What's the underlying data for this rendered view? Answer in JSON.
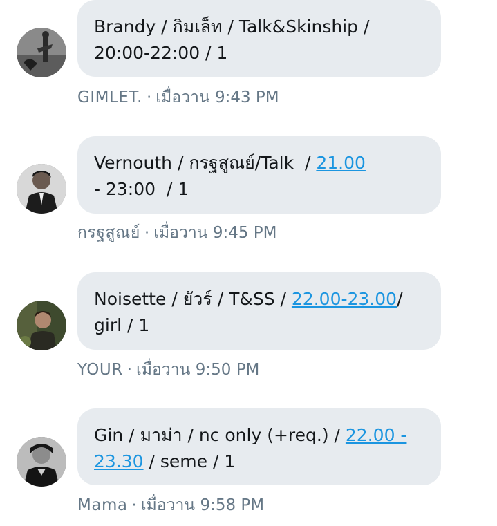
{
  "messages": [
    {
      "segments": [
        {
          "text": "Brandy / กิมเล็ท / Talk&Skinship /\n20:00-22:00 / 1",
          "link": false
        }
      ],
      "sender": "GIMLET.",
      "separator": "·",
      "time": "เมื่อวาน 9:43 PM",
      "avatar_icon": "profile-photo-icon"
    },
    {
      "segments": [
        {
          "text": "Vernouth / กรฐสูณย์/Talk  / ",
          "link": false
        },
        {
          "text": "21.00",
          "link": true
        },
        {
          "text": "\n- 23:00  / 1",
          "link": false
        }
      ],
      "sender": "กรฐสูณย์",
      "separator": "·",
      "time": "เมื่อวาน 9:45 PM",
      "avatar_icon": "profile-photo-icon"
    },
    {
      "segments": [
        {
          "text": "Noisette / ยัวร์ / T&SS / ",
          "link": false
        },
        {
          "text": "22.00-23.00",
          "link": true
        },
        {
          "text": "/\ngirl / 1",
          "link": false
        }
      ],
      "sender": "YOUR",
      "separator": "·",
      "time": "เมื่อวาน 9:50 PM",
      "avatar_icon": "profile-photo-icon"
    },
    {
      "segments": [
        {
          "text": "Gin / มาม่า / nc only (+req.) / ",
          "link": false
        },
        {
          "text": "22.00 -\n23.30",
          "link": true
        },
        {
          "text": " / seme / 1",
          "link": false
        }
      ],
      "sender": "Mama",
      "separator": "·",
      "time": "เมื่อวาน 9:58 PM",
      "avatar_icon": "profile-photo-icon"
    }
  ],
  "colors": {
    "bubble_bg": "#e7ebef",
    "text": "#14171a",
    "link": "#1b95e0",
    "meta": "#657786"
  }
}
